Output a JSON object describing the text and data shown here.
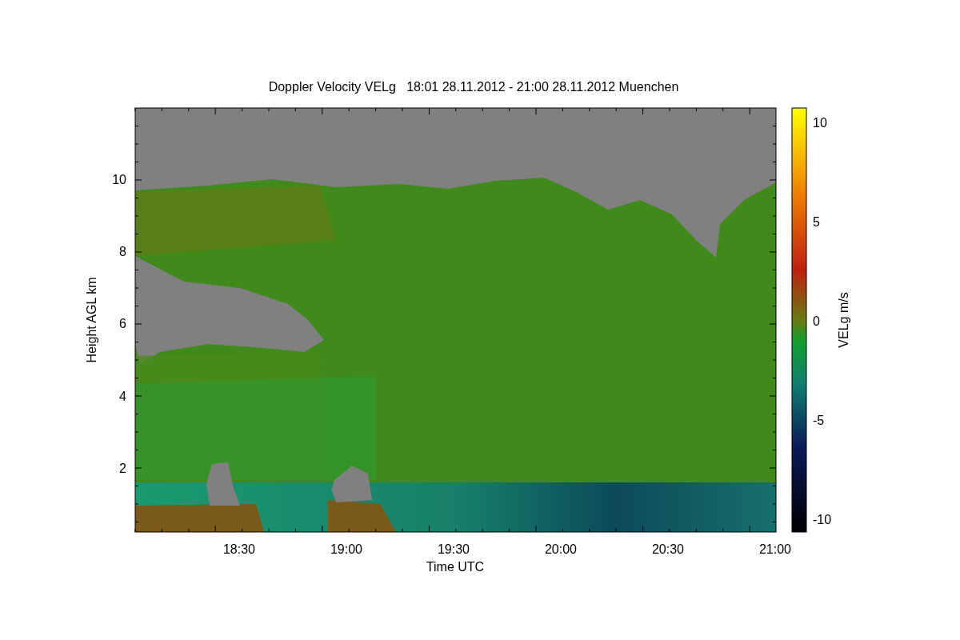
{
  "plot": {
    "title": "Doppler Velocity VELg   18:01 28.11.2012 - 21:00 28.11.2012 Muenchen",
    "xlabel": "Time UTC",
    "ylabel": "Height AGL km",
    "xtick_labels": [
      "18:30",
      "19:00",
      "19:30",
      "20:00",
      "20:30",
      "21:00"
    ],
    "ytick_labels": [
      "10",
      "8",
      "6",
      "4",
      "2"
    ]
  },
  "colorbar": {
    "label": "VELg m/s",
    "tick_labels": [
      "10",
      "5",
      "0",
      "-5",
      "-10"
    ]
  }
}
